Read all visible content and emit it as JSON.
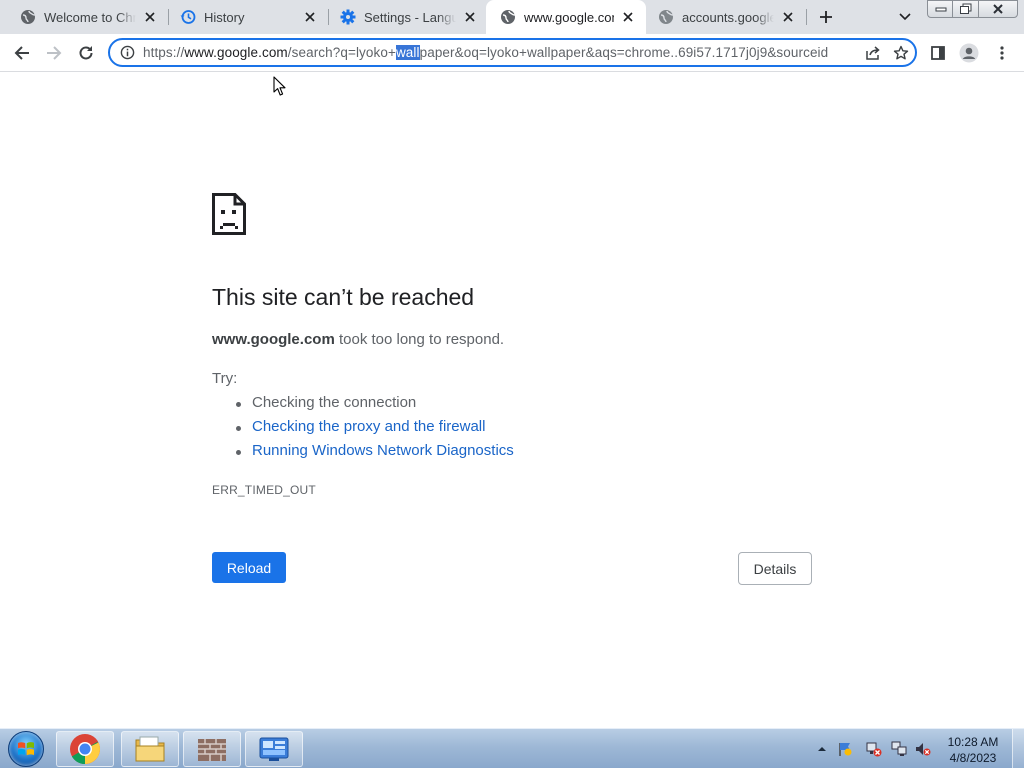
{
  "tabs": [
    {
      "title": "Welcome to Chrome",
      "icon": "globe-icon",
      "active": false
    },
    {
      "title": "History",
      "icon": "history-icon",
      "active": false
    },
    {
      "title": "Settings - Languages",
      "icon": "settings-gear-icon",
      "active": false
    },
    {
      "title": "www.google.com",
      "icon": "globe-icon",
      "active": true
    },
    {
      "title": "accounts.google.com",
      "icon": "globe-icon",
      "active": false
    }
  ],
  "omnibox": {
    "url_scheme": "https://",
    "url_host": "www.google.com",
    "url_path_before_sel": "/search?q=lyoko+",
    "url_selected": "wall",
    "url_path_after_sel": "paper&oq=lyoko+wallpaper&aqs=chrome..69i57.1717j0j9&sourceid"
  },
  "error": {
    "title": "This site can’t be reached",
    "host": "www.google.com",
    "desc_suffix": " took too long to respond.",
    "try_label": "Try:",
    "suggestions": [
      {
        "text": "Checking the connection",
        "link": false
      },
      {
        "text": "Checking the proxy and the firewall",
        "link": true
      },
      {
        "text": "Running Windows Network Diagnostics",
        "link": true
      }
    ],
    "code": "ERR_TIMED_OUT",
    "reload_label": "Reload",
    "details_label": "Details"
  },
  "taskbar": {
    "apps": [
      "chrome-icon",
      "file-explorer-icon",
      "firewall-icon",
      "control-panel-icon"
    ],
    "time": "10:28 AM",
    "date": "4/8/2023"
  },
  "colors": {
    "accent": "#1a73e8",
    "link": "#1a65c8",
    "tabstrip": "#dee1e6"
  }
}
